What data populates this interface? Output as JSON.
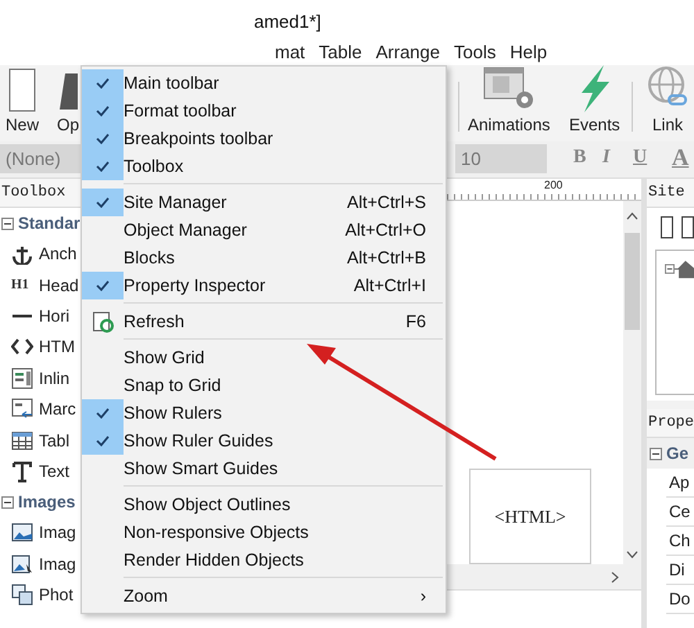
{
  "title": "amed1*]",
  "menu_bar": [
    "mat",
    "Table",
    "Arrange",
    "Tools",
    "Help"
  ],
  "toolbar": [
    {
      "kind": "new",
      "label": "New"
    },
    {
      "kind": "open",
      "label": "Op"
    },
    {
      "kind": "animations",
      "label": "Animations"
    },
    {
      "kind": "events",
      "label": "Events"
    },
    {
      "kind": "link",
      "label": "Link"
    }
  ],
  "format_bar": {
    "style": "(None)",
    "size": "10",
    "buttons": [
      "B",
      "I",
      "U",
      "A"
    ]
  },
  "toolbox": {
    "title": "Toolbox",
    "groups": [
      {
        "label": "Standar",
        "expanded": true,
        "items": [
          {
            "kind": "anchor",
            "label": "Anch"
          },
          {
            "kind": "heading",
            "label": "Head",
            "icon_text": "H1"
          },
          {
            "kind": "line",
            "label": "Hori"
          },
          {
            "kind": "code",
            "label": "HTM"
          },
          {
            "kind": "frame",
            "label": "Inlin"
          },
          {
            "kind": "marquee",
            "label": "Marc"
          },
          {
            "kind": "table",
            "label": "Tabl"
          },
          {
            "kind": "text",
            "label": "Text"
          }
        ]
      },
      {
        "label": "Images",
        "expanded": true,
        "items": [
          {
            "kind": "image",
            "label": "Imag"
          },
          {
            "kind": "imagemap",
            "label": "Imag"
          },
          {
            "kind": "gallery",
            "label": "Phot"
          }
        ]
      }
    ]
  },
  "ruler": "200",
  "canvas": {
    "object": "<HTML>"
  },
  "site_manager": {
    "title": "Site"
  },
  "properties": {
    "title": "Prope",
    "group": "Ge",
    "rows": [
      "Ap",
      "Ce",
      "Ch",
      "Di",
      "Do"
    ]
  },
  "context_menu": {
    "groups": [
      [
        {
          "kind": "check",
          "label": "Main toolbar",
          "checked": true
        },
        {
          "kind": "check",
          "label": "Format toolbar",
          "checked": true
        },
        {
          "kind": "check",
          "label": "Breakpoints toolbar",
          "checked": true
        },
        {
          "kind": "check",
          "label": "Toolbox",
          "checked": true
        }
      ],
      [
        {
          "kind": "check",
          "label": "Site Manager",
          "shortcut": "Alt+Ctrl+S",
          "checked": true
        },
        {
          "kind": "check",
          "label": "Object Manager",
          "shortcut": "Alt+Ctrl+O",
          "checked": false
        },
        {
          "kind": "check",
          "label": "Blocks",
          "shortcut": "Alt+Ctrl+B",
          "checked": false
        },
        {
          "kind": "check",
          "label": "Property Inspector",
          "shortcut": "Alt+Ctrl+I",
          "checked": true
        }
      ],
      [
        {
          "kind": "icon",
          "label": "Refresh",
          "shortcut": "F6"
        }
      ],
      [
        {
          "kind": "check",
          "label": "Show Grid",
          "checked": false
        },
        {
          "kind": "check",
          "label": "Snap to Grid",
          "checked": false
        },
        {
          "kind": "check",
          "label": "Show Rulers",
          "checked": true
        },
        {
          "kind": "check",
          "label": "Show Ruler Guides",
          "checked": true
        },
        {
          "kind": "check",
          "label": "Show Smart Guides",
          "checked": false
        }
      ],
      [
        {
          "kind": "check",
          "label": "Show Object Outlines",
          "checked": false
        },
        {
          "kind": "check",
          "label": "Non-responsive Objects",
          "checked": false
        },
        {
          "kind": "check",
          "label": "Render Hidden Objects",
          "checked": false
        }
      ],
      [
        {
          "kind": "submenu",
          "label": "Zoom",
          "arrow": "›"
        }
      ]
    ]
  }
}
